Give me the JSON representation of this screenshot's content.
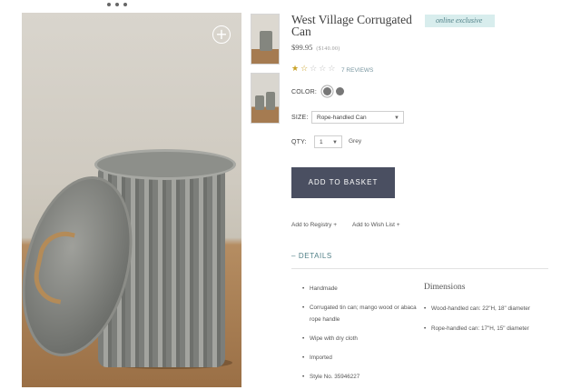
{
  "product": {
    "title": "West Village Corrugated Can",
    "badge": "online exclusive",
    "price": "$99.95",
    "old_price": "($140.00)",
    "rating": 1.5,
    "reviews_label": "7 REVIEWS"
  },
  "options": {
    "color_label": "COLOR:",
    "size_label": "SIZE:",
    "size_value": "Rope-handled Can",
    "qty_label": "QTY:",
    "qty_value": "1",
    "qty_note": "Grey"
  },
  "actions": {
    "add_to_basket": "ADD TO BASKET",
    "add_to_registry": "Add to Registry +",
    "add_to_wish_list": "Add to Wish List +"
  },
  "details": {
    "heading": "DETAILS",
    "items": [
      "Handmade",
      "Corrugated tin can; mango wood or abaca rope handle",
      "Wipe with dry cloth",
      "Imported",
      "Style No. 35946227"
    ],
    "dimensions_heading": "Dimensions",
    "dimensions": [
      "Wood-handled can: 22\"H, 18\" diameter",
      "Rope-handled can: 17\"H, 15\" diameter"
    ]
  },
  "colors": {
    "button": "#4a4f61",
    "accent": "#4f7f86",
    "badge_bg": "#d8eded"
  },
  "icons": [
    "zoom-plus-icon",
    "star-icon",
    "caret-down-icon"
  ]
}
